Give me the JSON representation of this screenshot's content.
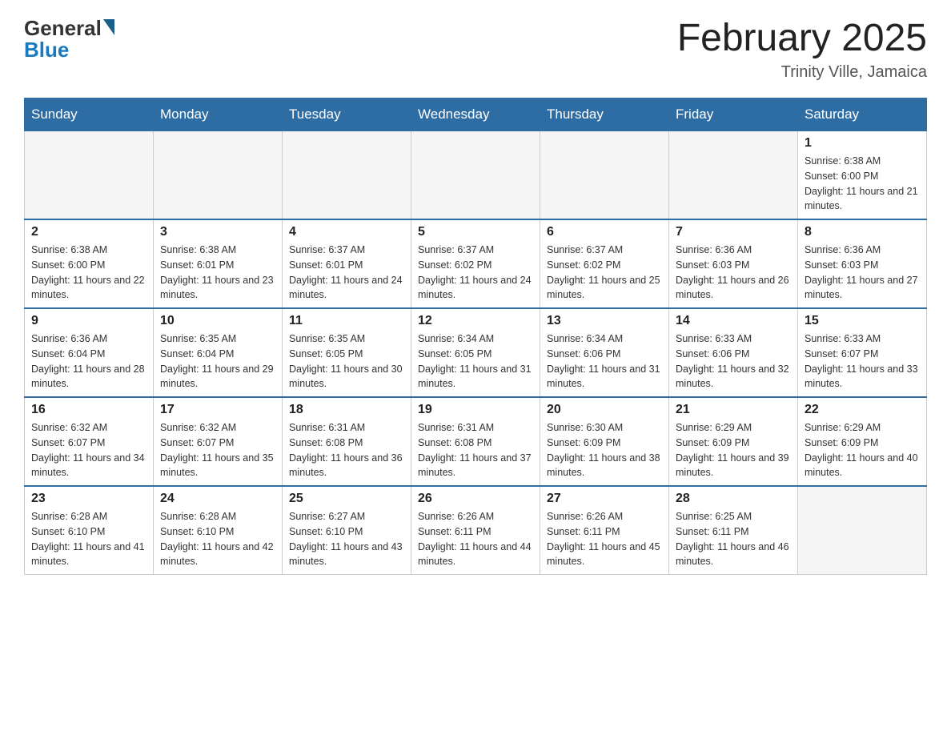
{
  "header": {
    "logo_general": "General",
    "logo_blue": "Blue",
    "title": "February 2025",
    "location": "Trinity Ville, Jamaica"
  },
  "days_of_week": [
    "Sunday",
    "Monday",
    "Tuesday",
    "Wednesday",
    "Thursday",
    "Friday",
    "Saturday"
  ],
  "weeks": [
    [
      {
        "day": "",
        "info": ""
      },
      {
        "day": "",
        "info": ""
      },
      {
        "day": "",
        "info": ""
      },
      {
        "day": "",
        "info": ""
      },
      {
        "day": "",
        "info": ""
      },
      {
        "day": "",
        "info": ""
      },
      {
        "day": "1",
        "info": "Sunrise: 6:38 AM\nSunset: 6:00 PM\nDaylight: 11 hours and 21 minutes."
      }
    ],
    [
      {
        "day": "2",
        "info": "Sunrise: 6:38 AM\nSunset: 6:00 PM\nDaylight: 11 hours and 22 minutes."
      },
      {
        "day": "3",
        "info": "Sunrise: 6:38 AM\nSunset: 6:01 PM\nDaylight: 11 hours and 23 minutes."
      },
      {
        "day": "4",
        "info": "Sunrise: 6:37 AM\nSunset: 6:01 PM\nDaylight: 11 hours and 24 minutes."
      },
      {
        "day": "5",
        "info": "Sunrise: 6:37 AM\nSunset: 6:02 PM\nDaylight: 11 hours and 24 minutes."
      },
      {
        "day": "6",
        "info": "Sunrise: 6:37 AM\nSunset: 6:02 PM\nDaylight: 11 hours and 25 minutes."
      },
      {
        "day": "7",
        "info": "Sunrise: 6:36 AM\nSunset: 6:03 PM\nDaylight: 11 hours and 26 minutes."
      },
      {
        "day": "8",
        "info": "Sunrise: 6:36 AM\nSunset: 6:03 PM\nDaylight: 11 hours and 27 minutes."
      }
    ],
    [
      {
        "day": "9",
        "info": "Sunrise: 6:36 AM\nSunset: 6:04 PM\nDaylight: 11 hours and 28 minutes."
      },
      {
        "day": "10",
        "info": "Sunrise: 6:35 AM\nSunset: 6:04 PM\nDaylight: 11 hours and 29 minutes."
      },
      {
        "day": "11",
        "info": "Sunrise: 6:35 AM\nSunset: 6:05 PM\nDaylight: 11 hours and 30 minutes."
      },
      {
        "day": "12",
        "info": "Sunrise: 6:34 AM\nSunset: 6:05 PM\nDaylight: 11 hours and 31 minutes."
      },
      {
        "day": "13",
        "info": "Sunrise: 6:34 AM\nSunset: 6:06 PM\nDaylight: 11 hours and 31 minutes."
      },
      {
        "day": "14",
        "info": "Sunrise: 6:33 AM\nSunset: 6:06 PM\nDaylight: 11 hours and 32 minutes."
      },
      {
        "day": "15",
        "info": "Sunrise: 6:33 AM\nSunset: 6:07 PM\nDaylight: 11 hours and 33 minutes."
      }
    ],
    [
      {
        "day": "16",
        "info": "Sunrise: 6:32 AM\nSunset: 6:07 PM\nDaylight: 11 hours and 34 minutes."
      },
      {
        "day": "17",
        "info": "Sunrise: 6:32 AM\nSunset: 6:07 PM\nDaylight: 11 hours and 35 minutes."
      },
      {
        "day": "18",
        "info": "Sunrise: 6:31 AM\nSunset: 6:08 PM\nDaylight: 11 hours and 36 minutes."
      },
      {
        "day": "19",
        "info": "Sunrise: 6:31 AM\nSunset: 6:08 PM\nDaylight: 11 hours and 37 minutes."
      },
      {
        "day": "20",
        "info": "Sunrise: 6:30 AM\nSunset: 6:09 PM\nDaylight: 11 hours and 38 minutes."
      },
      {
        "day": "21",
        "info": "Sunrise: 6:29 AM\nSunset: 6:09 PM\nDaylight: 11 hours and 39 minutes."
      },
      {
        "day": "22",
        "info": "Sunrise: 6:29 AM\nSunset: 6:09 PM\nDaylight: 11 hours and 40 minutes."
      }
    ],
    [
      {
        "day": "23",
        "info": "Sunrise: 6:28 AM\nSunset: 6:10 PM\nDaylight: 11 hours and 41 minutes."
      },
      {
        "day": "24",
        "info": "Sunrise: 6:28 AM\nSunset: 6:10 PM\nDaylight: 11 hours and 42 minutes."
      },
      {
        "day": "25",
        "info": "Sunrise: 6:27 AM\nSunset: 6:10 PM\nDaylight: 11 hours and 43 minutes."
      },
      {
        "day": "26",
        "info": "Sunrise: 6:26 AM\nSunset: 6:11 PM\nDaylight: 11 hours and 44 minutes."
      },
      {
        "day": "27",
        "info": "Sunrise: 6:26 AM\nSunset: 6:11 PM\nDaylight: 11 hours and 45 minutes."
      },
      {
        "day": "28",
        "info": "Sunrise: 6:25 AM\nSunset: 6:11 PM\nDaylight: 11 hours and 46 minutes."
      },
      {
        "day": "",
        "info": ""
      }
    ]
  ]
}
